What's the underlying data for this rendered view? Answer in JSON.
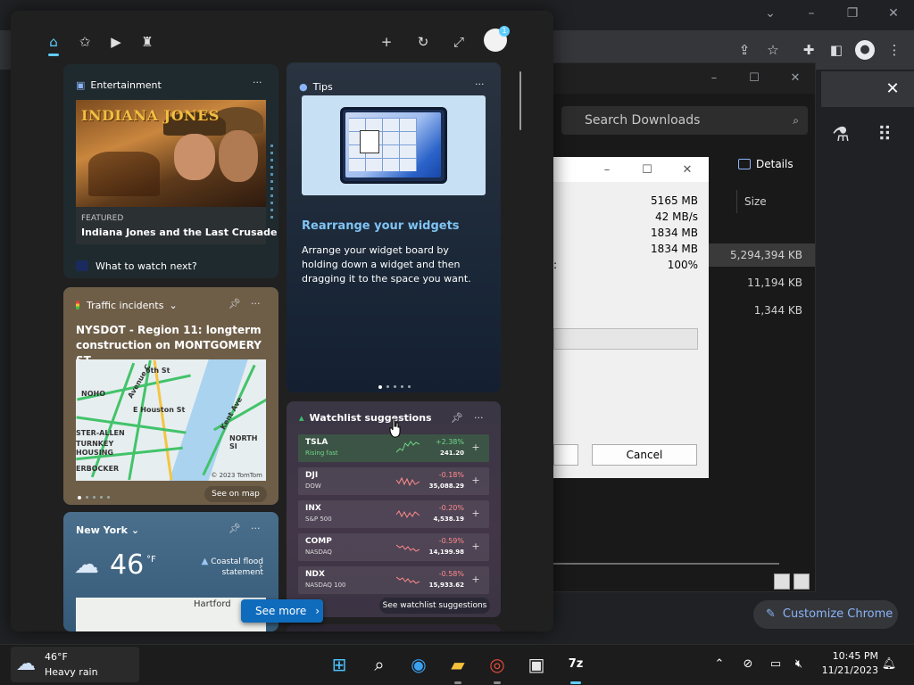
{
  "chrome": {
    "search_downloads_placeholder": "Search Downloads",
    "details_label": "Details",
    "size_header": "Size",
    "file_sizes": [
      "5,294,394 KB",
      "11,194 KB",
      "1,344 KB"
    ],
    "customize_label": "Customize Chrome"
  },
  "zip_dialog": {
    "values": [
      "5165 MB",
      "42 MB/s",
      "1834 MB",
      "1834 MB",
      "100%"
    ],
    "cancel_label": "Cancel"
  },
  "widgets": {
    "entertainment": {
      "header": "Entertainment",
      "image_logo_line1": "INDIANA JONES",
      "featured_label": "FEATURED",
      "title": "Indiana Jones and the Last Crusade",
      "what_to_watch": "What to watch next?"
    },
    "tips": {
      "header": "Tips",
      "heading": "Rearrange your widgets",
      "body": "Arrange your widget board by holding down a widget and then dragging it to the space you want."
    },
    "traffic": {
      "header": "Traffic incidents",
      "title": "NYSDOT - Region 11: longterm construction on MONTGOMERY ST...",
      "map_labels": {
        "noho": "NOHO",
        "houston": "E Houston St",
        "ave_c": "Avenue C",
        "sixth": "6th St",
        "kent": "Kent Ave",
        "north_si": "NORTH SI",
        "sterallen": "STER-ALLEN",
        "turnkey": "TURNKEY",
        "housing": "HOUSING",
        "erbocker": "ERBOCKER"
      },
      "map_credit": "© 2023 TomTom",
      "see_on_map": "See on map"
    },
    "weather": {
      "location": "New York",
      "temperature": "46",
      "unit": "°F",
      "alert": "Coastal flood statement",
      "map_label": "Hartford"
    },
    "watchlist": {
      "header": "Watchlist suggestions",
      "stocks": [
        {
          "symbol": "TSLA",
          "sub": "Rising fast",
          "change": "+2.38%",
          "price": "241.20",
          "up": true
        },
        {
          "symbol": "DJI",
          "sub": "DOW",
          "change": "-0.18%",
          "price": "35,088.29",
          "up": false
        },
        {
          "symbol": "INX",
          "sub": "S&P 500",
          "change": "-0.20%",
          "price": "4,538.19",
          "up": false
        },
        {
          "symbol": "COMP",
          "sub": "NASDAQ",
          "change": "-0.59%",
          "price": "14,199.98",
          "up": false
        },
        {
          "symbol": "NDX",
          "sub": "NASDAQ 100",
          "change": "-0.58%",
          "price": "15,933.62",
          "up": false
        }
      ],
      "see_suggestions": "See watchlist suggestions"
    },
    "see_more_label": "See more",
    "avatar_badge": "1"
  },
  "taskbar": {
    "weather_temp": "46°F",
    "weather_desc": "Heavy rain",
    "time": "10:45 PM",
    "date": "11/21/2023"
  },
  "colors": {
    "accent": "#60cdff",
    "see_more": "#0f6cbd",
    "positive": "#6fd68a",
    "negative": "#ff8b8b"
  }
}
